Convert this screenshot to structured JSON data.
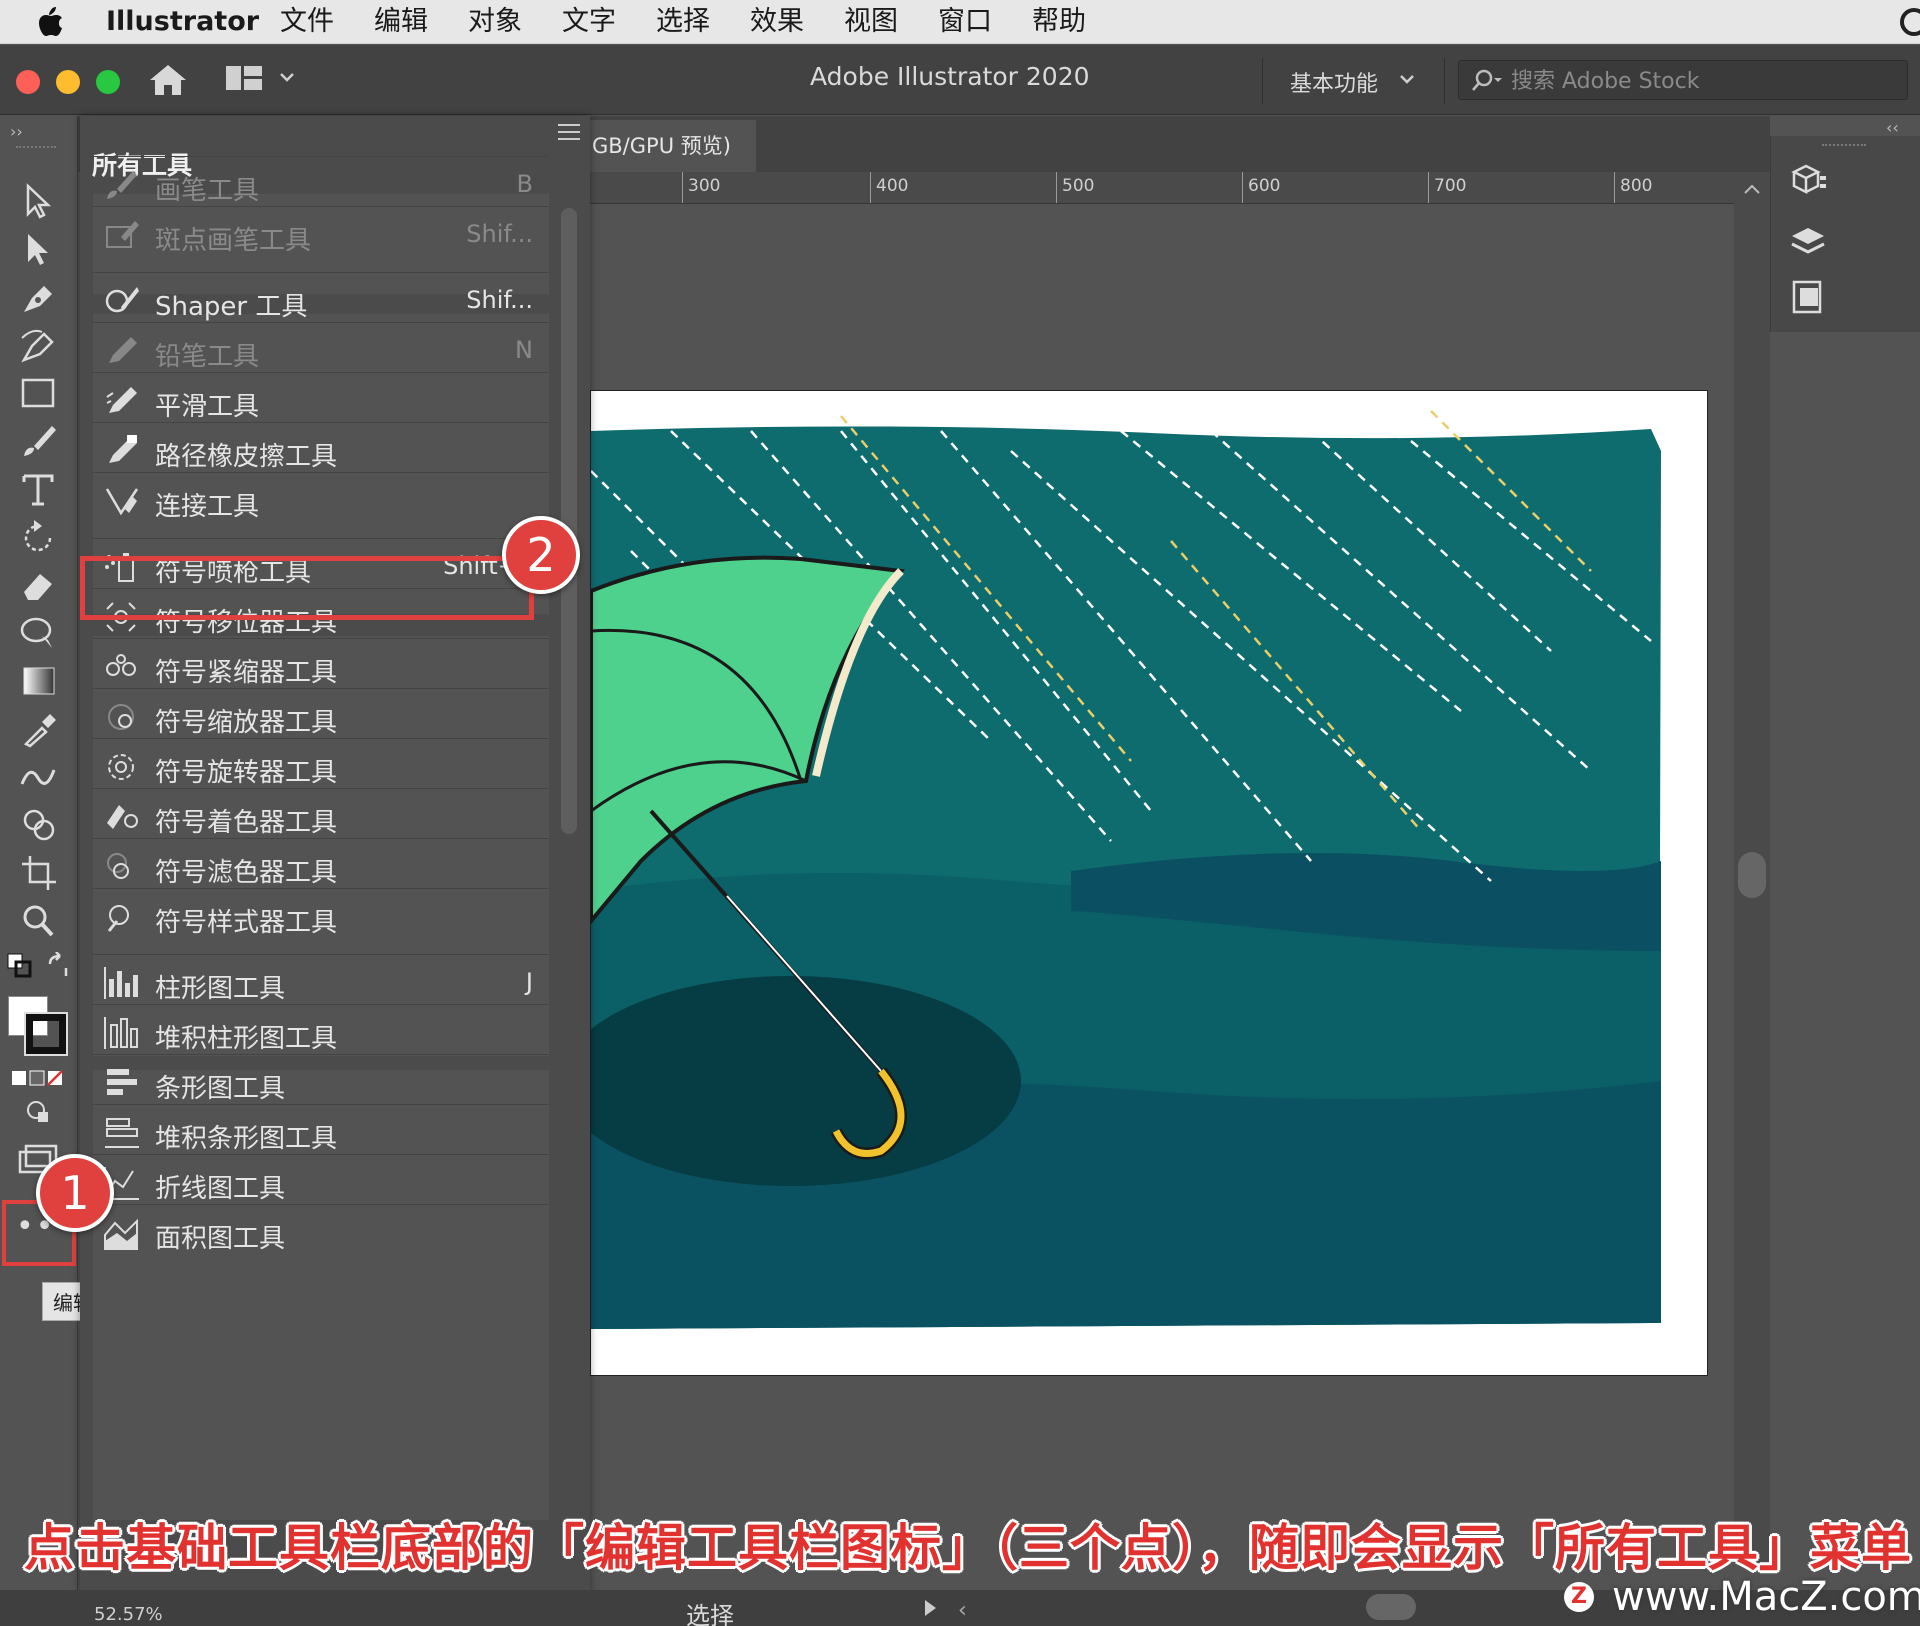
{
  "menubar": {
    "app": "Illustrator",
    "items": [
      "文件",
      "编辑",
      "对象",
      "文字",
      "选择",
      "效果",
      "视图",
      "窗口",
      "帮助"
    ]
  },
  "titlebar": {
    "title": "Adobe Illustrator 2020",
    "workspace": "基本功能",
    "search_placeholder": "搜索 Adobe Stock"
  },
  "document": {
    "tab_label": "GB/GPU 预览)"
  },
  "ruler": {
    "labels": [
      "300",
      "400",
      "500",
      "600",
      "700",
      "800"
    ]
  },
  "popup": {
    "title": "所有工具",
    "rows": [
      {
        "label": "画笔工具",
        "key": "B",
        "dim": true,
        "icon": "brush-icon"
      },
      {
        "label": "斑点画笔工具",
        "key": "Shif...",
        "dim": true,
        "icon": "blob-brush-icon"
      },
      {
        "label": "Shaper 工具",
        "key": "Shif...",
        "dim": false,
        "icon": "shaper-icon"
      },
      {
        "label": "铅笔工具",
        "key": "N",
        "dim": true,
        "icon": "pencil-icon"
      },
      {
        "label": "平滑工具",
        "key": "",
        "dim": false,
        "icon": "smooth-icon"
      },
      {
        "label": "路径橡皮擦工具",
        "key": "",
        "dim": false,
        "icon": "path-eraser-icon"
      },
      {
        "label": "连接工具",
        "key": "",
        "dim": false,
        "icon": "join-icon"
      },
      {
        "label": "符号喷枪工具",
        "key": "Shift+S",
        "dim": false,
        "icon": "symbol-sprayer-icon"
      },
      {
        "label": "符号移位器工具",
        "key": "",
        "dim": false,
        "icon": "symbol-shifter-icon"
      },
      {
        "label": "符号紧缩器工具",
        "key": "",
        "dim": false,
        "icon": "symbol-scruncher-icon"
      },
      {
        "label": "符号缩放器工具",
        "key": "",
        "dim": false,
        "icon": "symbol-sizer-icon"
      },
      {
        "label": "符号旋转器工具",
        "key": "",
        "dim": false,
        "icon": "symbol-spinner-icon"
      },
      {
        "label": "符号着色器工具",
        "key": "",
        "dim": false,
        "icon": "symbol-stainer-icon"
      },
      {
        "label": "符号滤色器工具",
        "key": "",
        "dim": false,
        "icon": "symbol-screener-icon"
      },
      {
        "label": "符号样式器工具",
        "key": "",
        "dim": false,
        "icon": "symbol-styler-icon"
      },
      {
        "label": "柱形图工具",
        "key": "J",
        "dim": false,
        "icon": "column-graph-icon"
      },
      {
        "label": "堆积柱形图工具",
        "key": "",
        "dim": false,
        "icon": "stacked-column-graph-icon"
      },
      {
        "label": "条形图工具",
        "key": "",
        "dim": false,
        "icon": "bar-graph-icon"
      },
      {
        "label": "堆积条形图工具",
        "key": "",
        "dim": false,
        "icon": "stacked-bar-graph-icon"
      },
      {
        "label": "折线图工具",
        "key": "",
        "dim": false,
        "icon": "line-graph-icon"
      },
      {
        "label": "面积图工具",
        "key": "",
        "dim": false,
        "icon": "area-graph-icon"
      }
    ]
  },
  "badges": {
    "one": "1",
    "two": "2"
  },
  "toolbar": {
    "tooltip": "编辑工具栏...",
    "edit_button": "•••"
  },
  "status": {
    "zoom": "52.57%",
    "label": "选择"
  },
  "caption": "点击基础工具栏底部的「编辑工具栏图标」（三个点），随即会显示「所有工具」菜单",
  "watermark": "www.MacZ.com",
  "watermark_logo": "Z",
  "colors": {
    "highlight": "#e0403e",
    "artwork_bg": "#0e6b6e",
    "umbrella": "#4fd18e"
  }
}
